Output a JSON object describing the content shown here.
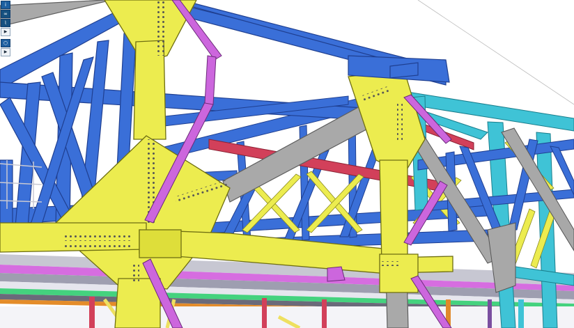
{
  "viewer": {
    "background": "#ffffff",
    "member_colors": {
      "truss_blue": "#3a6fd8",
      "gusset_yellow": "#ecec4f",
      "brace_magenta": "#cc66dd",
      "chord_red": "#d2405a",
      "cyan_frame": "#3fc3d6",
      "grey_strut": "#a8a8a8",
      "deck_green": "#3fcf7a",
      "column_orange": "#e0892a"
    }
  },
  "toolbar": {
    "buttons": [
      {
        "icon": "info-icon",
        "glyph": "i"
      },
      {
        "icon": "link-icon",
        "glyph": "∞"
      },
      {
        "icon": "measure-icon",
        "glyph": "⌇"
      },
      {
        "icon": "expand-arrow-icon",
        "glyph": "▶"
      },
      {
        "icon": "cube-view-icon",
        "glyph": "⬡"
      },
      {
        "icon": "expand-arrow-icon",
        "glyph": "▶"
      }
    ]
  }
}
